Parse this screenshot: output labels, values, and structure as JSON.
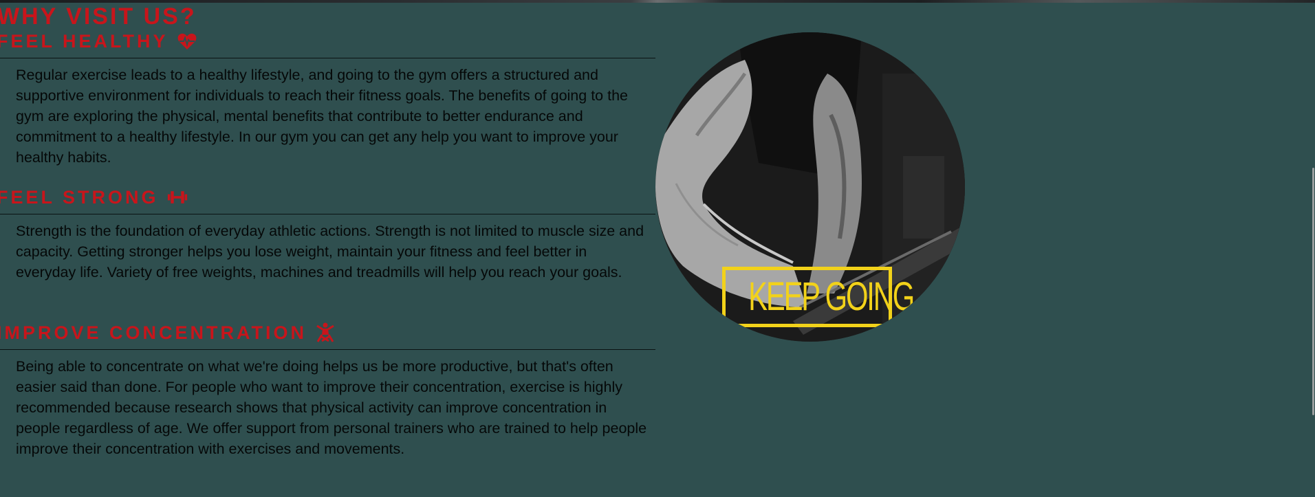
{
  "section": {
    "title": "WHY VISIT US?",
    "items": [
      {
        "heading": "FEEL HEALTHY",
        "icon": "heartbeat-icon",
        "text": "Regular exercise leads to a healthy lifestyle, and going to the gym offers a structured and supportive environment for individuals to reach their fitness goals. The benefits of going to the gym are exploring the physical, mental benefits that contribute to better endurance and commitment to a healthy lifestyle. In our gym you can get any help you want to improve your healthy habits."
      },
      {
        "heading": "FEEL STRONG",
        "icon": "dumbbell-icon",
        "text": "Strength is the foundation of everyday athletic actions. Strength is not limited to muscle size and capacity. Getting stronger helps you lose weight, maintain your fitness and feel better in everyday life. Variety of free weights, machines and treadmills will help you reach your goals."
      },
      {
        "heading": "IMPROVE CONCENTRATION",
        "icon": "meditation-icon",
        "text": "Being able to concentrate on what we're doing helps us be more productive, but that's often easier said than done. For people who want to improve their concentration, exercise is highly recommended because research shows that physical activity can improve concentration in people regardless of age. We offer support from personal trainers who are trained to help people improve their concentration with exercises and movements."
      }
    ],
    "image_caption": "KEEP GOING"
  },
  "colors": {
    "background": "#2f4f4f",
    "heading": "#c8151b",
    "body_text": "#050808",
    "accent_yellow": "#f2d21a"
  }
}
